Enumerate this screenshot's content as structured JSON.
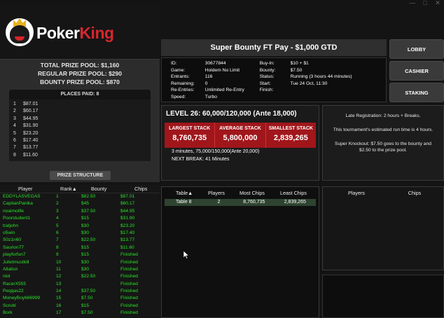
{
  "window": {
    "controls": [
      "—",
      "□",
      "✕"
    ]
  },
  "logo": {
    "part1": "Poker",
    "part2": "King"
  },
  "prize": {
    "total": "TOTAL PRIZE POOL: $1,160",
    "regular": "REGULAR PRIZE POOL: $290",
    "bounty": "BOUNTY PRIZE POOL: $870",
    "places_header": "PLACES PAID: 8",
    "places": [
      {
        "n": "1",
        "amount": "$87.01"
      },
      {
        "n": "2",
        "amount": "$60.17"
      },
      {
        "n": "3",
        "amount": "$44.95"
      },
      {
        "n": "4",
        "amount": "$31.90"
      },
      {
        "n": "5",
        "amount": "$23.20"
      },
      {
        "n": "6",
        "amount": "$17.40"
      },
      {
        "n": "7",
        "amount": "$13.77"
      },
      {
        "n": "8",
        "amount": "$11.60"
      }
    ],
    "structure_button": "PRIZE STRUCTURE"
  },
  "players": {
    "headers": [
      "Player",
      "Rank▲",
      "Bounty",
      "Chips"
    ],
    "rows": [
      {
        "name": "EDDYLASVEGAS",
        "rank": "1",
        "bounty": "$82.50",
        "chips": "$87.01"
      },
      {
        "name": "CapitanPanika",
        "rank": "2",
        "bounty": "$45",
        "chips": "$60.17"
      },
      {
        "name": "noaimolife",
        "rank": "3",
        "bounty": "$37.50",
        "chips": "$44.95"
      },
      {
        "name": "Poorstudent1",
        "rank": "4",
        "bounty": "$15",
        "chips": "$31.90"
      },
      {
        "name": "tratjohn",
        "rank": "5",
        "bounty": "$30",
        "chips": "$23.20"
      },
      {
        "name": "o5win",
        "rank": "6",
        "bounty": "$30",
        "chips": "$17.40"
      },
      {
        "name": "S0z1n60",
        "rank": "7",
        "bounty": "$22.50",
        "chips": "$13.77"
      },
      {
        "name": "Saurion77",
        "rank": "8",
        "bounty": "$15",
        "chips": "$11.60"
      },
      {
        "name": "playforfun7",
        "rank": "9",
        "bounty": "$15",
        "chips": "Finished"
      },
      {
        "name": "Julietmustkill",
        "rank": "10",
        "bounty": "$30",
        "chips": "Finished"
      },
      {
        "name": "Allatisn",
        "rank": "11",
        "bounty": "$30",
        "chips": "Finished"
      },
      {
        "name": "niol",
        "rank": "12",
        "bounty": "$22.50",
        "chips": "Finished"
      },
      {
        "name": "RacerX555",
        "rank": "13",
        "bounty": "",
        "chips": "Finished"
      },
      {
        "name": "Peqqas22",
        "rank": "14",
        "bounty": "$37.50",
        "chips": "Finished"
      },
      {
        "name": "MoneyBoy666999",
        "rank": "15",
        "bounty": "$7.50",
        "chips": "Finished"
      },
      {
        "name": "Scrubl",
        "rank": "16",
        "bounty": "$15",
        "chips": "Finished"
      },
      {
        "name": "Bork",
        "rank": "17",
        "bounty": "$7.50",
        "chips": "Finished"
      }
    ]
  },
  "tournament": {
    "title": "Super Bounty FT Pay - $1,000 GTD",
    "info": [
      {
        "k": "ID:",
        "v": "30677844",
        "k2": "Buy-In:",
        "v2": "$10 + $1"
      },
      {
        "k": "Game:",
        "v": "Holdem No Limit",
        "k2": "Bounty:",
        "v2": "$7.50"
      },
      {
        "k": "Entrants:",
        "v": "116",
        "k2": "Status:",
        "v2": "Running (3 hours 44 minutes)"
      },
      {
        "k": "Remaining:",
        "v": "0",
        "k2": "Start:",
        "v2": "Tue 24 Oct, 11:30"
      },
      {
        "k": "Re-Entries:",
        "v": "Unlimited Re-Entry",
        "k2": "Finish:",
        "v2": ""
      },
      {
        "k": "Speed:",
        "v": "Turbo",
        "k2": "",
        "v2": ""
      }
    ]
  },
  "buttons": {
    "lobby": "LOBBY",
    "cashier": "CASHIER",
    "staking": "STAKING"
  },
  "level": {
    "title": "LEVEL 26: 60,000/120,000 (Ante 18,000)",
    "largest_label": "LARGEST STACK",
    "largest_value": "8,760,735",
    "average_label": "AVERAGE STACK",
    "average_value": "5,800,000",
    "smallest_label": "SMALLEST STACK",
    "smallest_value": "2,839,265",
    "next_level": "3 minutes, 75,000/150,000(Ante 20,000)",
    "next_break": "NEXT BREAK: 41 Minutes"
  },
  "notes": {
    "p1": "Late Registration: 2 hours + Breaks.",
    "p2": "This tournament's estimated run time is 4 hours.",
    "p3": "Super Knockout: $7.50 goes to the bounty and $2.50 to the prize pool."
  },
  "tables": {
    "headers": [
      "Table▲",
      "Players",
      "Most Chips",
      "Least Chips"
    ],
    "rows": [
      {
        "table": "Table 8",
        "players": "2",
        "most": "8,760,735",
        "least": "2,839,265"
      }
    ]
  },
  "table_players": {
    "headers": [
      "Players",
      "Chips"
    ]
  }
}
